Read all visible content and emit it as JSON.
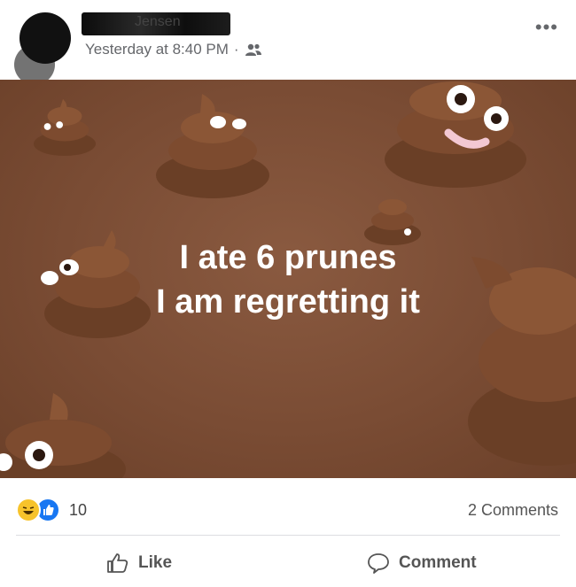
{
  "post": {
    "author_name": "Jensen",
    "timestamp": "Yesterday at 8:40 PM",
    "separator": "·",
    "audience_icon": "friends-icon",
    "more_icon": "more-options-icon",
    "text_line1": "I ate 6 prunes",
    "text_line2": "I am regretting it",
    "image_background": "#7a4c34"
  },
  "reactions": {
    "icons": [
      "haha-icon",
      "like-icon"
    ],
    "count": "10",
    "comments_label": "2 Comments"
  },
  "actions": {
    "like_label": "Like",
    "comment_label": "Comment"
  },
  "colors": {
    "secondary_text": "#65676b",
    "like_blue": "#1877f2",
    "haha_yellow": "#f7c32b"
  }
}
